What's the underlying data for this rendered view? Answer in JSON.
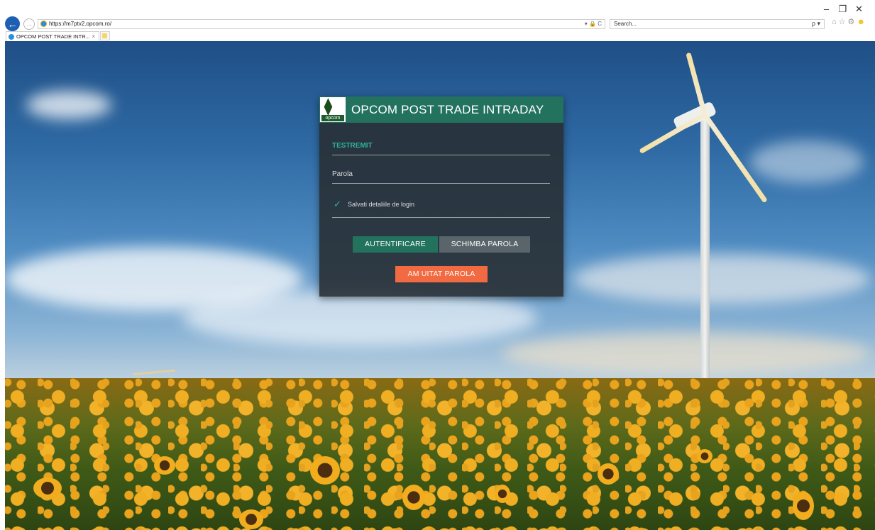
{
  "browser": {
    "back_icon": "back-arrow-icon",
    "forward_icon": "forward-arrow-icon",
    "url": "https://m7ptv2.opcom.ro/",
    "address_controls": "▾ 🔒 C",
    "search_placeholder": "Search...",
    "search_icon": "ρ ▾",
    "tab_title": "OPCOM POST TRADE INTR...",
    "tab_close": "×",
    "toolbar_icons": [
      "home-icon",
      "favorites-star-icon",
      "settings-gear-icon",
      "feedback-smiley-icon"
    ],
    "window_controls": {
      "minimize": "–",
      "maximize": "❐",
      "close": "✕"
    }
  },
  "login": {
    "logo_label": "opcom",
    "title": "OPCOM POST TRADE INTRADAY",
    "username_value": "TESTREMIT",
    "password_placeholder": "Parola",
    "remember_label": "Salvati detaliile de login",
    "remember_checked": true,
    "buttons": {
      "login": "AUTENTIFICARE",
      "change_password": "SCHIMBA PAROLA",
      "forgot_password": "AM UITAT PAROLA"
    }
  },
  "colors": {
    "header_green": "#22725e",
    "accent_teal": "#2fb39a",
    "button_grey": "#59656b",
    "button_orange": "#f26a41",
    "panel_dark": "#282f34"
  }
}
